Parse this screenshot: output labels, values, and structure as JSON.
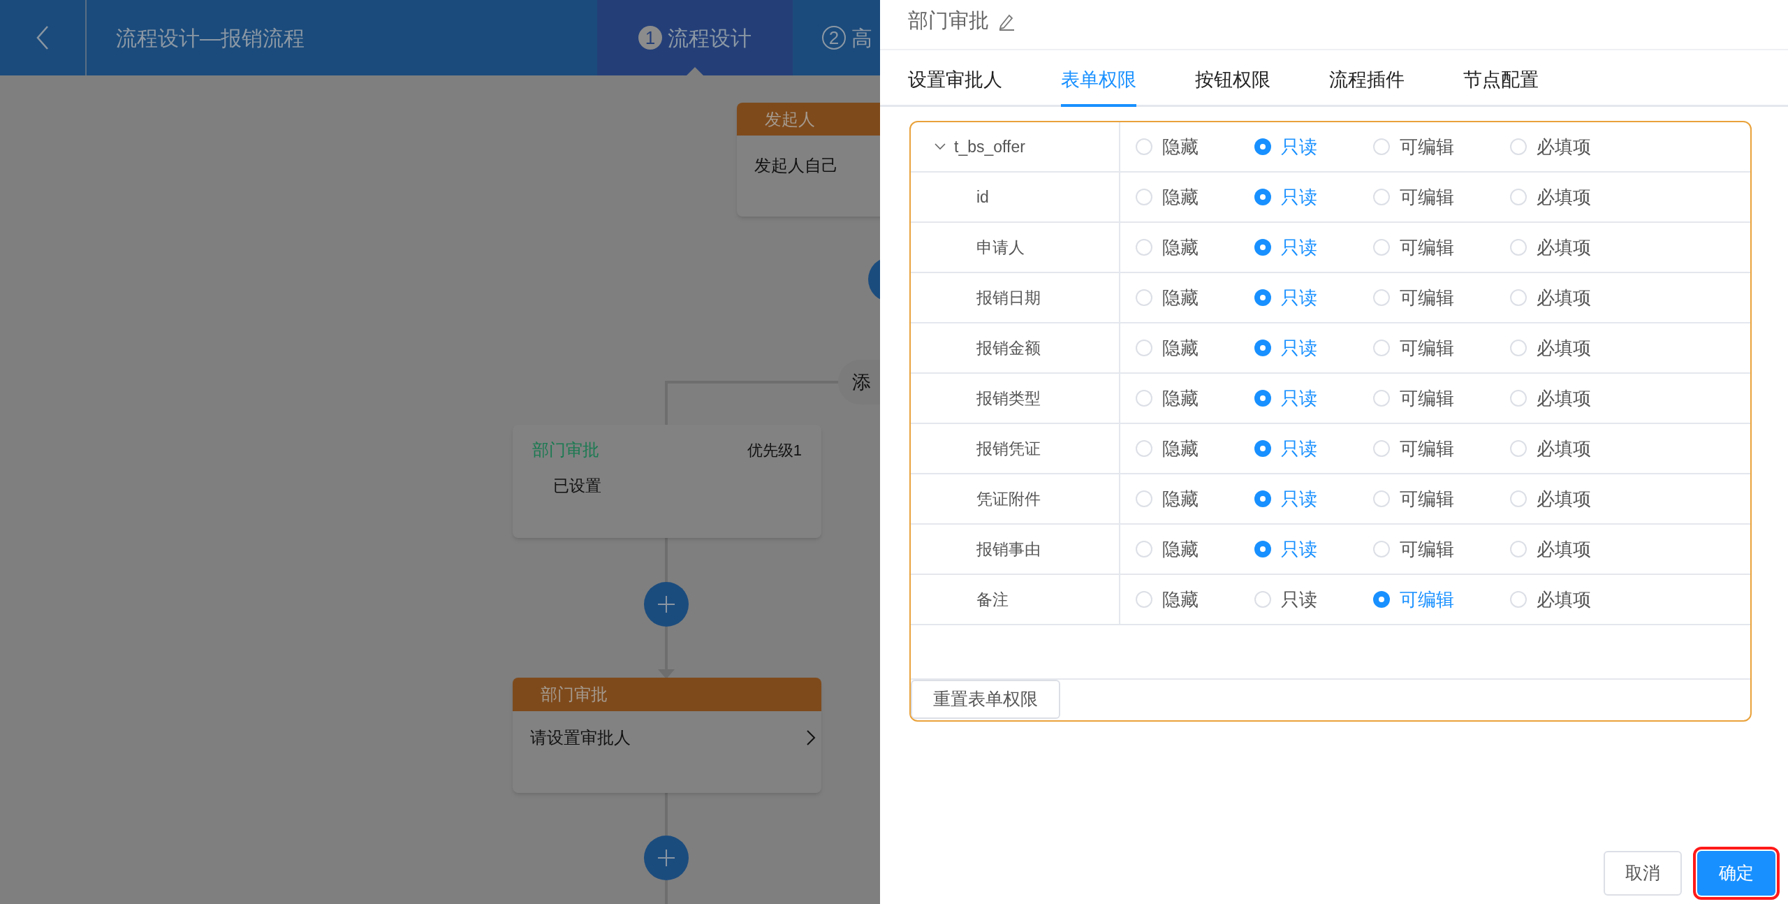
{
  "header": {
    "title": "流程设计—报销流程",
    "steps": [
      {
        "number": "1",
        "label": "流程设计",
        "selected": true
      },
      {
        "number": "2",
        "label": "高",
        "selected": false
      }
    ]
  },
  "flow": {
    "start_node": {
      "header": "发起人",
      "body": "发起人自己"
    },
    "add_branch_label": "添",
    "branch_card": {
      "title": "部门审批",
      "priority": "优先级1",
      "body": "已设置"
    },
    "approver_node": {
      "header": "部门审批",
      "body": "请设置审批人"
    }
  },
  "drawer": {
    "title": "部门审批",
    "tabs": [
      {
        "label": "设置审批人",
        "selected": false
      },
      {
        "label": "表单权限",
        "selected": true
      },
      {
        "label": "按钮权限",
        "selected": false
      },
      {
        "label": "流程插件",
        "selected": false
      },
      {
        "label": "节点配置",
        "selected": false
      }
    ],
    "permission_tree": [
      {
        "label": "t_bs_offer",
        "expanded": true,
        "options": [
          {
            "label": "隐藏",
            "selected": false
          },
          {
            "label": "只读",
            "selected": true
          },
          {
            "label": "可编辑",
            "selected": false
          },
          {
            "label": "必填项",
            "selected": false
          }
        ],
        "children": [
          {
            "label": "id",
            "options": [
              {
                "label": "隐藏",
                "selected": false
              },
              {
                "label": "只读",
                "selected": true
              },
              {
                "label": "可编辑",
                "selected": false
              },
              {
                "label": "必填项",
                "selected": false
              }
            ]
          },
          {
            "label": "申请人",
            "options": [
              {
                "label": "隐藏",
                "selected": false
              },
              {
                "label": "只读",
                "selected": true
              },
              {
                "label": "可编辑",
                "selected": false
              },
              {
                "label": "必填项",
                "selected": false
              }
            ]
          },
          {
            "label": "报销日期",
            "options": [
              {
                "label": "隐藏",
                "selected": false
              },
              {
                "label": "只读",
                "selected": true
              },
              {
                "label": "可编辑",
                "selected": false
              },
              {
                "label": "必填项",
                "selected": false
              }
            ]
          },
          {
            "label": "报销金额",
            "options": [
              {
                "label": "隐藏",
                "selected": false
              },
              {
                "label": "只读",
                "selected": true
              },
              {
                "label": "可编辑",
                "selected": false
              },
              {
                "label": "必填项",
                "selected": false
              }
            ]
          },
          {
            "label": "报销类型",
            "options": [
              {
                "label": "隐藏",
                "selected": false
              },
              {
                "label": "只读",
                "selected": true
              },
              {
                "label": "可编辑",
                "selected": false
              },
              {
                "label": "必填项",
                "selected": false
              }
            ]
          },
          {
            "label": "报销凭证",
            "options": [
              {
                "label": "隐藏",
                "selected": false
              },
              {
                "label": "只读",
                "selected": true
              },
              {
                "label": "可编辑",
                "selected": false
              },
              {
                "label": "必填项",
                "selected": false
              }
            ]
          },
          {
            "label": "凭证附件",
            "options": [
              {
                "label": "隐藏",
                "selected": false
              },
              {
                "label": "只读",
                "selected": true
              },
              {
                "label": "可编辑",
                "selected": false
              },
              {
                "label": "必填项",
                "selected": false
              }
            ]
          },
          {
            "label": "报销事由",
            "options": [
              {
                "label": "隐藏",
                "selected": false
              },
              {
                "label": "只读",
                "selected": true
              },
              {
                "label": "可编辑",
                "selected": false
              },
              {
                "label": "必填项",
                "selected": false
              }
            ]
          },
          {
            "label": "备注",
            "options": [
              {
                "label": "隐藏",
                "selected": false
              },
              {
                "label": "只读",
                "selected": false
              },
              {
                "label": "可编辑",
                "selected": true
              },
              {
                "label": "必填项",
                "selected": false
              }
            ]
          }
        ]
      }
    ],
    "reset_button": "重置表单权限",
    "buttons": [
      {
        "label": "取消",
        "kind": "default",
        "highlighted": false
      },
      {
        "label": "确定",
        "kind": "primary",
        "highlighted": true
      }
    ]
  }
}
